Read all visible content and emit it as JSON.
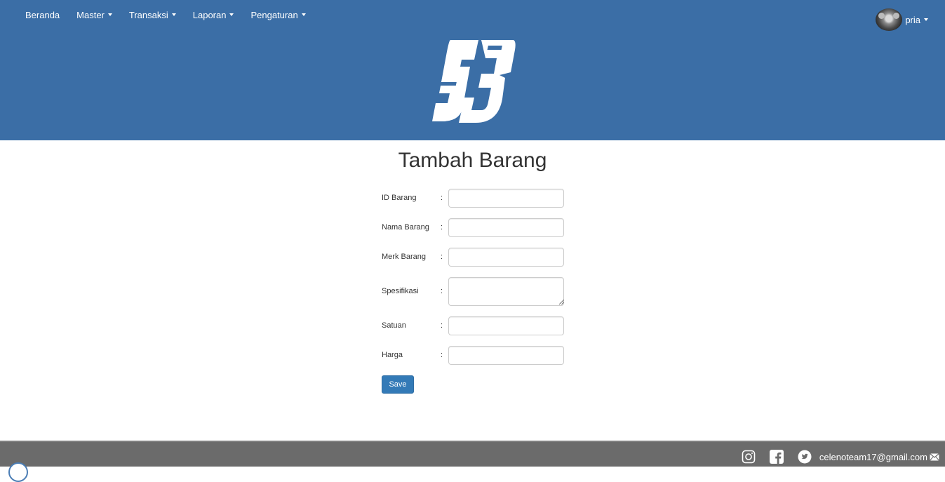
{
  "nav": {
    "items": [
      {
        "label": "Beranda",
        "dropdown": false
      },
      {
        "label": "Master",
        "dropdown": true
      },
      {
        "label": "Transaksi",
        "dropdown": true
      },
      {
        "label": "Laporan",
        "dropdown": true
      },
      {
        "label": "Pengaturan",
        "dropdown": true
      }
    ],
    "user": {
      "name": "pria"
    }
  },
  "brand": {
    "logo": "sb-logo",
    "header_color": "#3b6ea6"
  },
  "page": {
    "title": "Tambah Barang"
  },
  "form": {
    "colon": ":",
    "fields": [
      {
        "label": "ID Barang",
        "value": "",
        "type": "text"
      },
      {
        "label": "Nama Barang",
        "value": "",
        "type": "text"
      },
      {
        "label": "Merk Barang",
        "value": "",
        "type": "text"
      },
      {
        "label": "Spesifikasi",
        "value": "",
        "type": "textarea"
      },
      {
        "label": "Satuan",
        "value": "",
        "type": "text"
      },
      {
        "label": "Harga",
        "value": "",
        "type": "text"
      }
    ],
    "save_label": "Save"
  },
  "footer": {
    "icons": [
      "instagram-icon",
      "facebook-icon",
      "twitter-icon"
    ],
    "email": "celenoteam17@gmail.com",
    "background": "#6b6b6b"
  }
}
